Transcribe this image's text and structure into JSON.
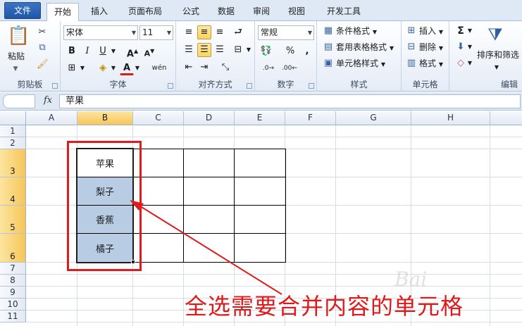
{
  "tabs": [
    "文件",
    "开始",
    "插入",
    "页面布局",
    "公式",
    "数据",
    "审阅",
    "视图",
    "开发工具"
  ],
  "active_tab": "开始",
  "clipboard": {
    "paste": "粘贴",
    "label": "剪贴板"
  },
  "font": {
    "name": "宋体",
    "size": "11",
    "label": "字体",
    "bold": "B",
    "italic": "I",
    "underline": "U",
    "phonetic": "wén"
  },
  "alignment": {
    "label": "对齐方式"
  },
  "number": {
    "format": "常规",
    "percent": "%",
    "comma": ",",
    "label": "数字"
  },
  "styles": {
    "conditional": "条件格式",
    "table": "套用表格格式",
    "cell": "单元格样式",
    "label": "样式"
  },
  "cells": {
    "insert": "插入",
    "delete": "删除",
    "format": "格式",
    "label": "单元格"
  },
  "editing": {
    "sort": "排序和筛选",
    "label": "编辑",
    "sum": "Σ"
  },
  "formula_bar": {
    "fx": "fx",
    "content": "苹果"
  },
  "columns": [
    "A",
    "B",
    "C",
    "D",
    "E",
    "F",
    "G",
    "H"
  ],
  "rows": [
    "1",
    "2",
    "3",
    "4",
    "5",
    "6",
    "7",
    "8",
    "9",
    "10",
    "11"
  ],
  "cell_values": {
    "B3": "苹果",
    "B4": "梨子",
    "B5": "香蕉",
    "B6": "橘子"
  },
  "annotation": "全选需要合并内容的单元格",
  "watermark": "Bai",
  "colors": {
    "selection_fill": "#b8cce4",
    "highlight_header": "#f6c659",
    "annotation_red": "#e11b1b"
  }
}
